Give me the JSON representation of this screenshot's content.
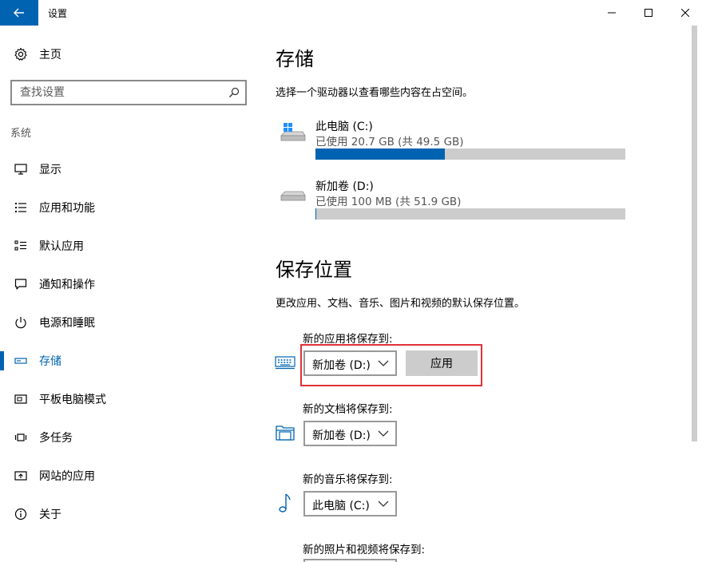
{
  "window": {
    "title": "设置"
  },
  "sidebar": {
    "home_label": "主页",
    "search_placeholder": "查找设置",
    "section_label": "系统",
    "items": [
      {
        "label": "显示",
        "icon": "monitor-icon"
      },
      {
        "label": "应用和功能",
        "icon": "list-icon"
      },
      {
        "label": "默认应用",
        "icon": "default-apps-icon"
      },
      {
        "label": "通知和操作",
        "icon": "notification-icon"
      },
      {
        "label": "电源和睡眠",
        "icon": "power-icon"
      },
      {
        "label": "存储",
        "icon": "storage-icon",
        "selected": true
      },
      {
        "label": "平板电脑模式",
        "icon": "tablet-icon"
      },
      {
        "label": "多任务",
        "icon": "multitask-icon"
      },
      {
        "label": "网站的应用",
        "icon": "web-apps-icon"
      },
      {
        "label": "关于",
        "icon": "info-icon"
      }
    ]
  },
  "storage": {
    "title": "存储",
    "description": "选择一个驱动器以查看哪些内容在占空间。",
    "drives": [
      {
        "name": "此电脑 (C:)",
        "usage": "已使用 20.7 GB (共 49.5 GB)",
        "used_fraction": 0.418,
        "icon": "windows-drive-icon"
      },
      {
        "name": "新加卷 (D:)",
        "usage": "已使用 100 MB (共 51.9 GB)",
        "used_fraction": 0.002,
        "icon": "drive-icon"
      }
    ]
  },
  "save_locations": {
    "title": "保存位置",
    "description": "更改应用、文档、音乐、图片和视频的默认保存位置。",
    "apply_label": "应用",
    "rows": [
      {
        "label": "新的应用将保存到:",
        "value": "新加卷 (D:)",
        "icon": "keyboard-icon",
        "has_apply": true
      },
      {
        "label": "新的文档将保存到:",
        "value": "新加卷 (D:)",
        "icon": "folder-icon"
      },
      {
        "label": "新的音乐将保存到:",
        "value": "此电脑 (C:)",
        "icon": "music-note-icon"
      },
      {
        "label": "新的照片和视频将保存到:",
        "value": "",
        "icon": ""
      }
    ]
  },
  "colors": {
    "accent": "#0063b1",
    "highlight": "#e0303a",
    "bar_track": "#cccccc"
  }
}
